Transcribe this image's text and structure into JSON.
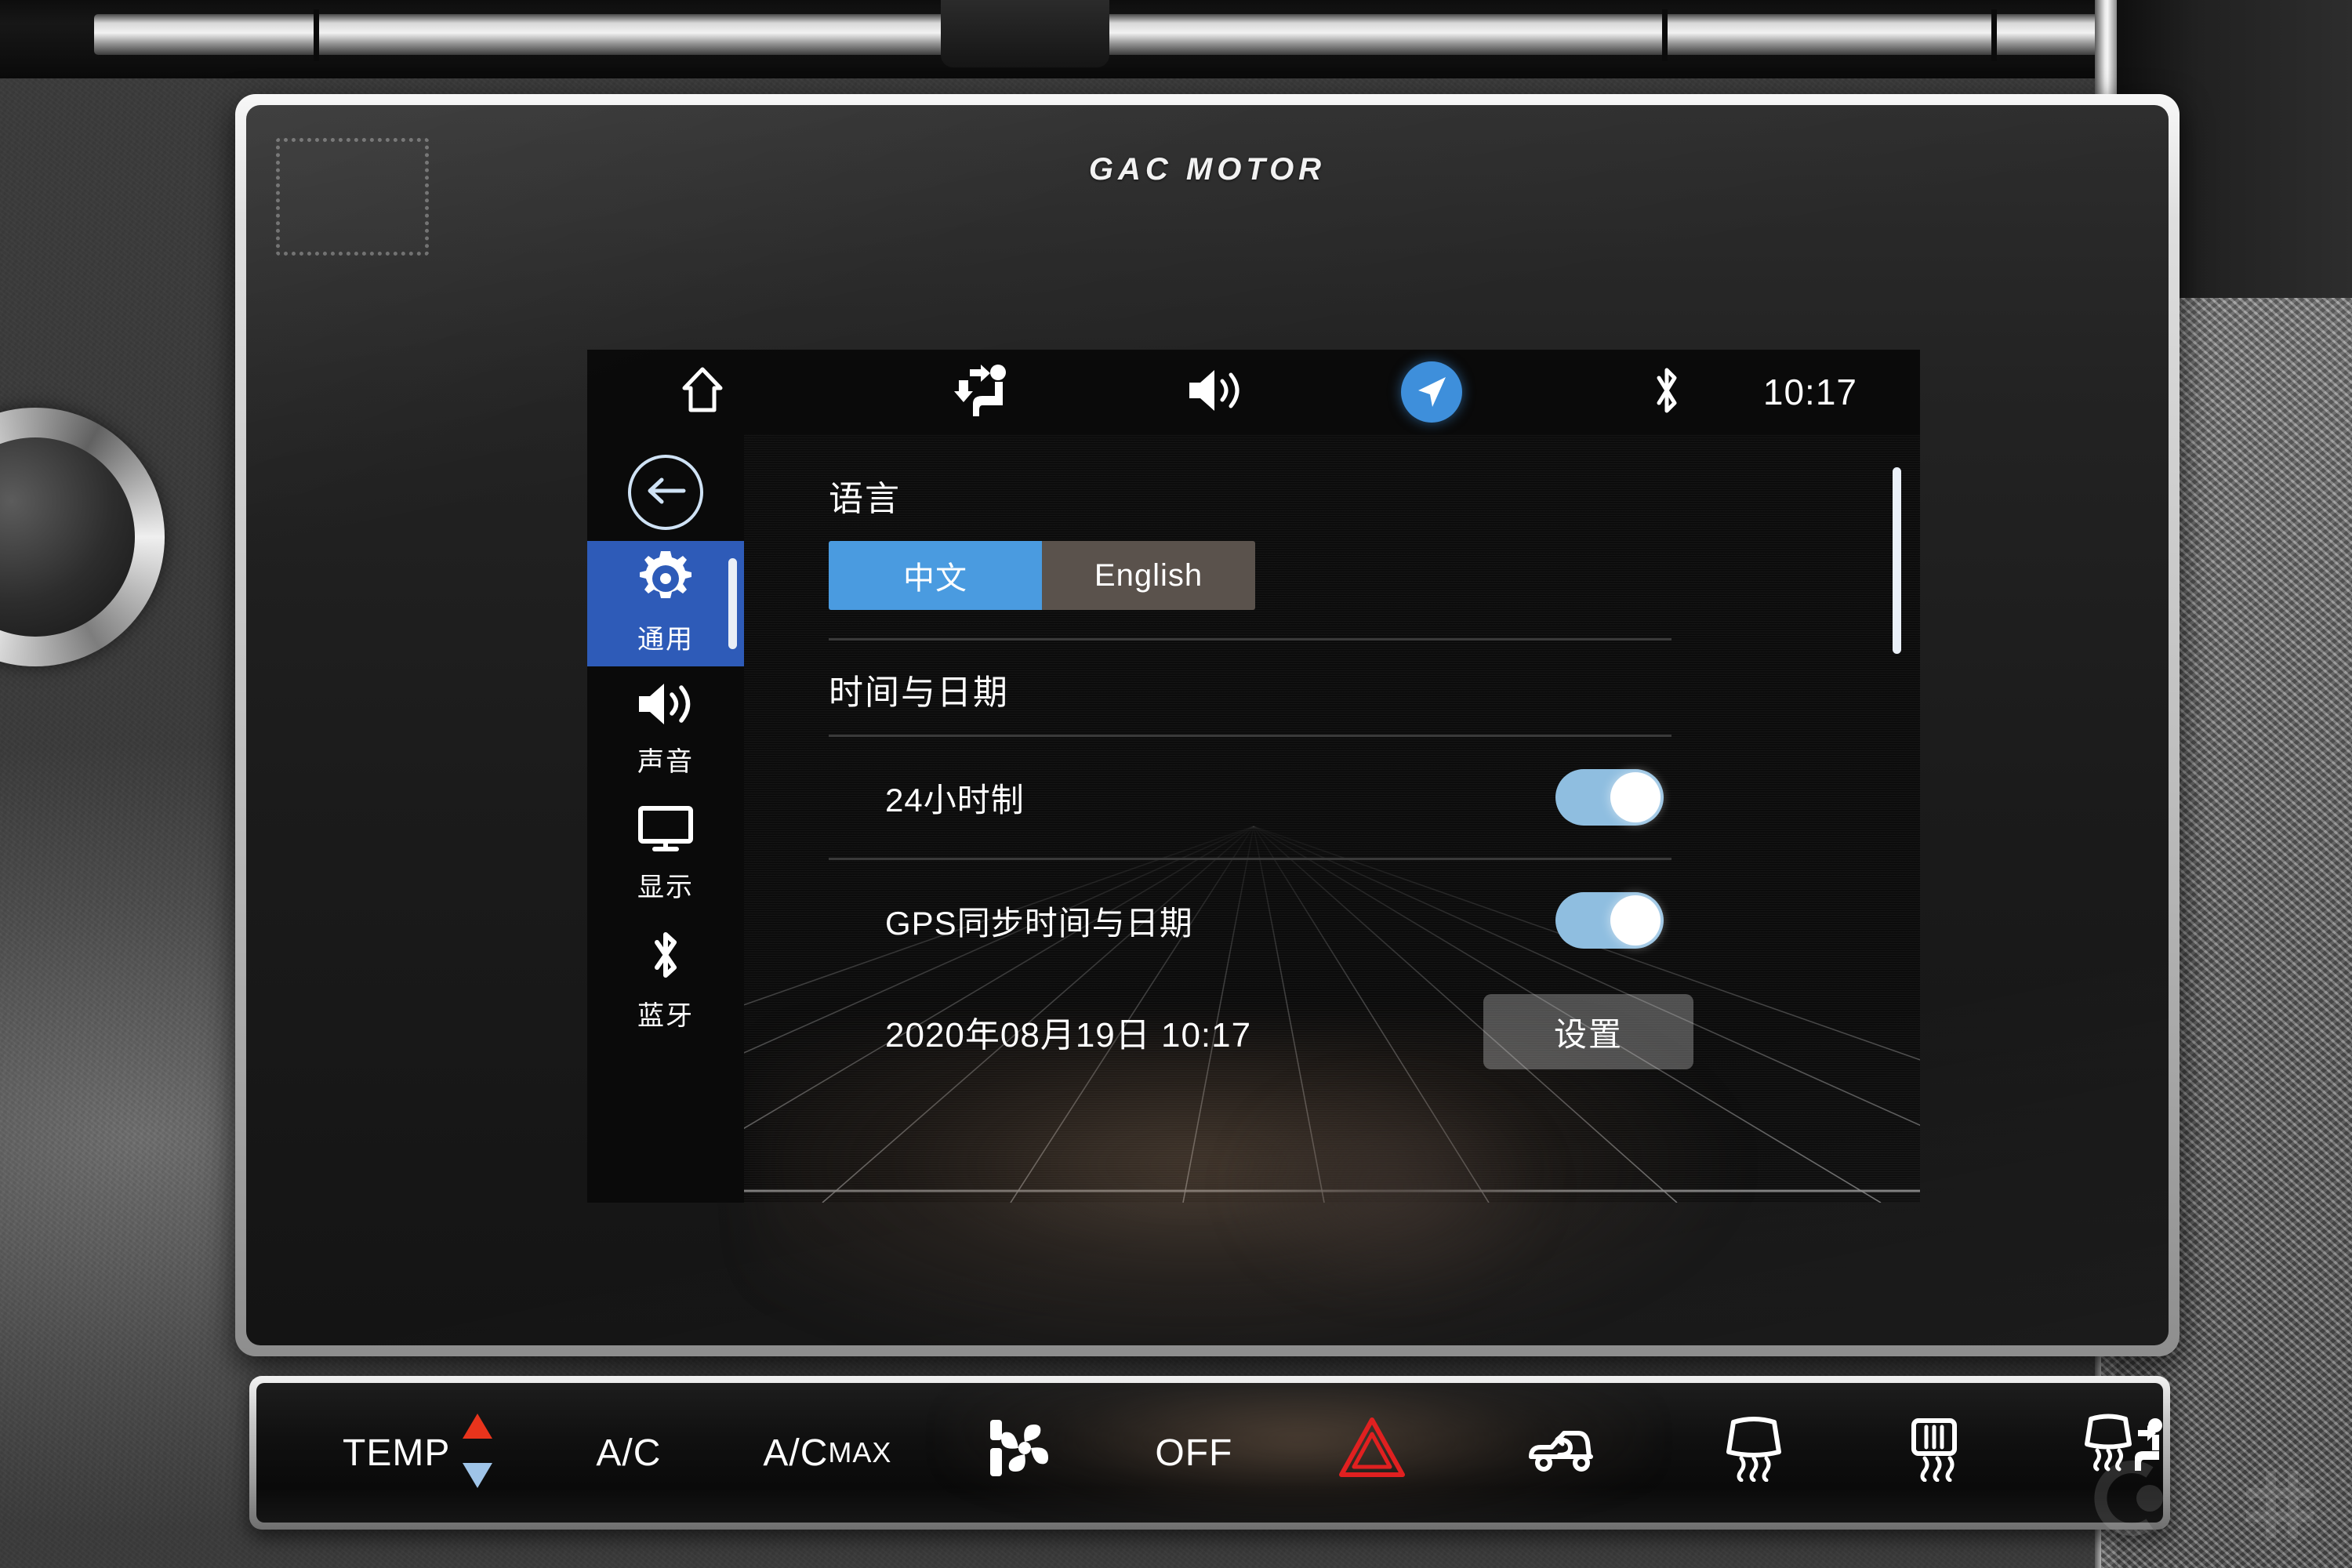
{
  "vehicle": {
    "brand": "GAC MOTOR"
  },
  "status_bar": {
    "home_icon": "home-icon",
    "airflow_icon": "seat-airflow-icon",
    "volume_icon": "volume-icon",
    "navigation_icon": "navigation-arrow-icon",
    "bluetooth_icon": "bluetooth-icon",
    "clock": "10:17"
  },
  "sidebar": {
    "back_icon": "back-arrow-icon",
    "items": [
      {
        "label": "通用",
        "icon": "gear-icon",
        "active": true
      },
      {
        "label": "声音",
        "icon": "volume-icon",
        "active": false
      },
      {
        "label": "显示",
        "icon": "monitor-icon",
        "active": false
      },
      {
        "label": "蓝牙",
        "icon": "bluetooth-icon",
        "active": false
      }
    ]
  },
  "settings": {
    "language": {
      "title": "语言",
      "options": [
        {
          "label": "中文",
          "selected": true
        },
        {
          "label": "English",
          "selected": false
        }
      ]
    },
    "datetime": {
      "title": "时间与日期",
      "rows": [
        {
          "label": "24小时制",
          "toggle": "on"
        },
        {
          "label": "GPS同步时间与日期",
          "toggle": "on"
        }
      ],
      "current_value": "2020年08月19日 10:17",
      "button_label": "设置"
    }
  },
  "climate_bar": {
    "temp_label": "TEMP",
    "temp_up_icon": "arrow-up-icon",
    "temp_down_icon": "arrow-down-icon",
    "ac_label": "A/C",
    "acmax_label_main": "A/C",
    "acmax_label_sub": "MAX",
    "fan_icon": "fan-icon",
    "off_label": "OFF",
    "hazard_icon": "hazard-triangle-icon",
    "recirculate_icon": "air-recirculation-icon",
    "front_defrost_icon": "front-defrost-icon",
    "rear_defrost_icon": "rear-defrost-icon",
    "auto_defog_icon": "auto-defog-icon"
  },
  "colors": {
    "accent_blue": "#3E8FDB",
    "sidebar_active": "#2E5BB8",
    "segment_on": "#4A9BE0",
    "segment_off": "#5A524C",
    "toggle_track": "#8FBEE0",
    "hazard_red": "#E02020",
    "temp_up_red": "#E8341C",
    "temp_down_blue": "#9FC4E8"
  }
}
